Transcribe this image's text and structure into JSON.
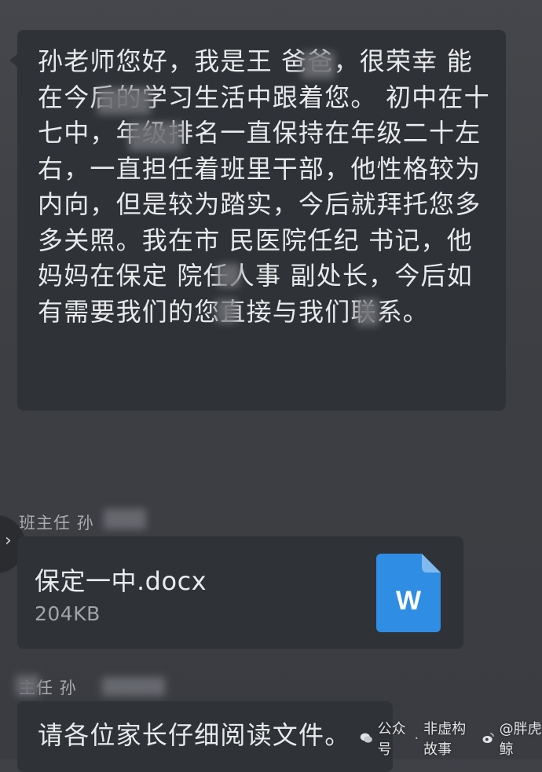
{
  "messages": [
    {
      "text": "孙老师您好，我是王 爸爸，很荣幸 能在今后的学习生活中跟着您。 初中在十七中，年级排名一直保持在年级二十左右，一直担任着班里干部，他性格较为内向，但是较为踏实，今后就拜托您多多关照。我在市 民医院任纪 书记，他妈妈在保定 院任人事 副处长，今后如有需要我们的您直接与我们联系。"
    }
  ],
  "sender_1": "班主任 孙",
  "file": {
    "name": "保定一中.docx",
    "size": "204KB",
    "icon_letter": "W",
    "icon_color": "#2f8de4"
  },
  "sender_2": "主任 孙",
  "message_2": "请各位家长仔细阅读文件。",
  "side_tab_glyph": "›",
  "watermark": {
    "platform": "公众号",
    "account": "非虚构故事",
    "weibo_handle": "@胖虎鲸",
    "weibo_icon": "weibo-icon",
    "wechat_icon": "wechat-icon"
  }
}
